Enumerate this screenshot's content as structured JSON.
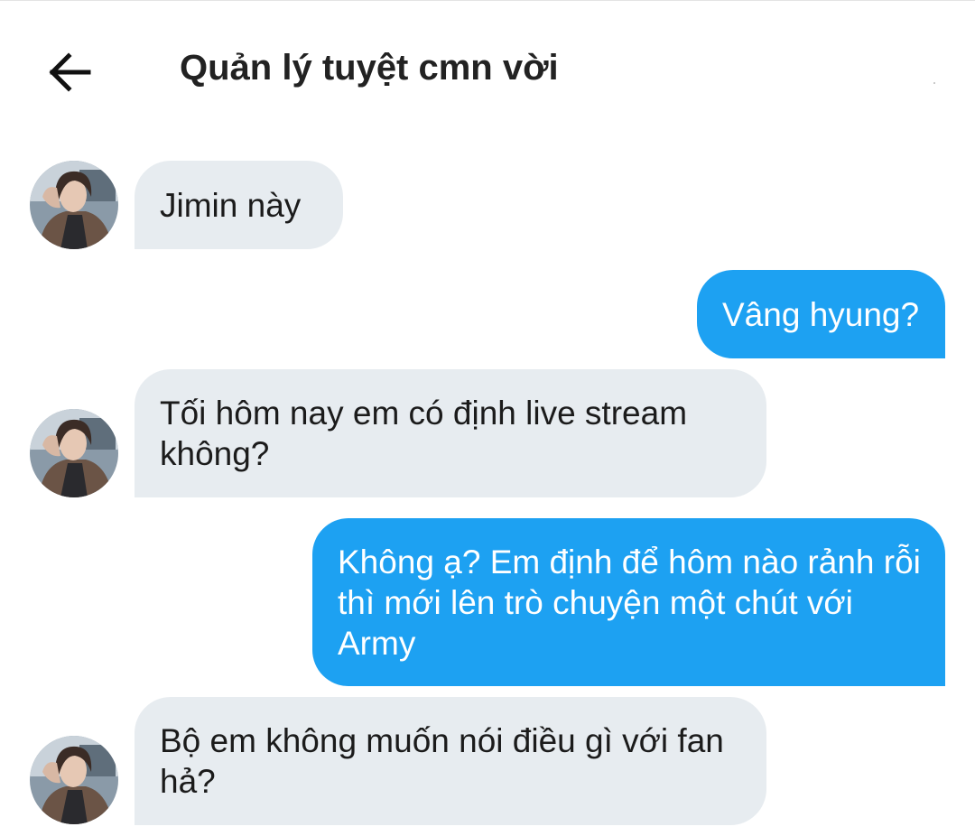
{
  "header": {
    "back_icon": "arrow-left-icon",
    "title": "Quản lý tuyệt cmn vời"
  },
  "conversation": {
    "colors": {
      "incoming_bg": "#e7ecf0",
      "outgoing_bg": "#1da1f2",
      "outgoing_text": "#ffffff"
    },
    "messages": [
      {
        "sender": "other",
        "text": "Jimin này"
      },
      {
        "sender": "me",
        "text": "Vâng hyung?"
      },
      {
        "sender": "other",
        "text": "Tối hôm nay em có định live stream không?"
      },
      {
        "sender": "me",
        "text": "Không ạ? Em định để hôm nào rảnh rỗi thì mới lên trò chuyện một chút với Army"
      },
      {
        "sender": "other",
        "text": "Bộ em không muốn nói điều gì với fan hả?"
      }
    ]
  }
}
